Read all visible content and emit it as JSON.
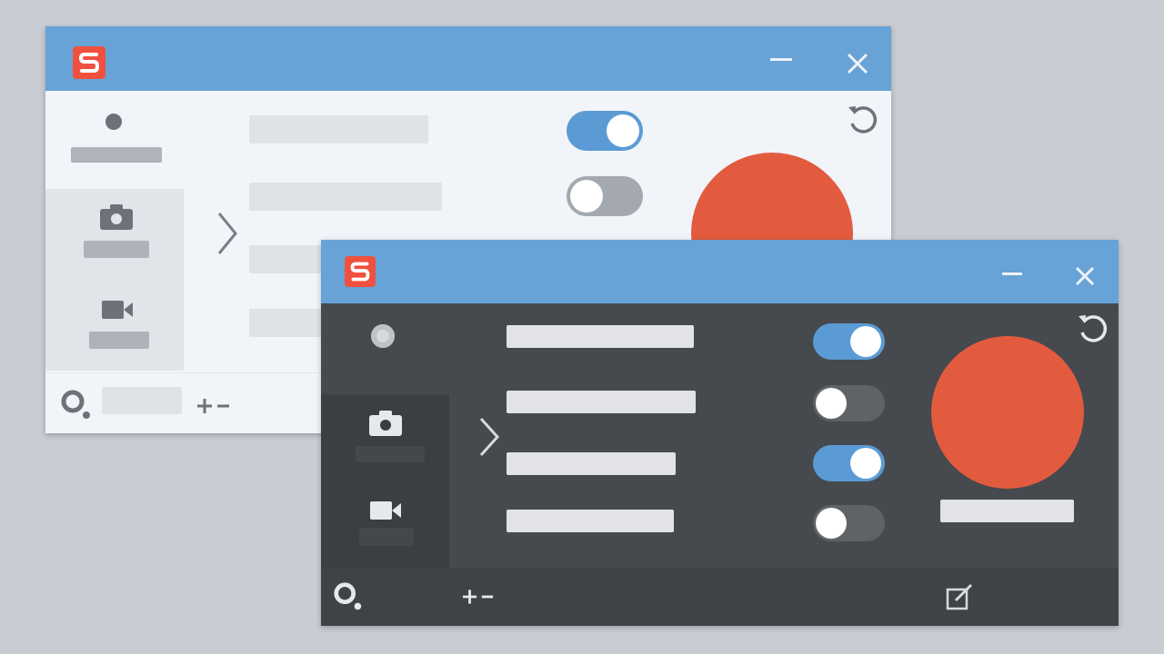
{
  "theme_colors": {
    "background": "#c9ccd3",
    "titlebar": "#67a3d6",
    "logo": "#f0513f",
    "record_button": "#e35b3f",
    "toggle_on": "#5b9bd5",
    "light_panel": "#f1f4f8",
    "dark_panel": "#46494e"
  },
  "windows": [
    {
      "theme": "light",
      "title_icon": "app-logo-icon",
      "controls": [
        "minimize-icon",
        "close-icon"
      ],
      "tabs": [
        {
          "icon": "screen-record-icon",
          "selected": false
        },
        {
          "icon": "camera-icon",
          "selected": true
        },
        {
          "icon": "video-camera-icon",
          "selected": true
        }
      ],
      "toggles": [
        true,
        false
      ],
      "footer_icons": [
        "settings-icon",
        "zoom-icon"
      ],
      "reset_icon": "reset-icon",
      "record_button": "record-button"
    },
    {
      "theme": "dark",
      "title_icon": "app-logo-icon",
      "controls": [
        "minimize-icon",
        "close-icon"
      ],
      "tabs": [
        {
          "icon": "screen-record-icon",
          "selected": false
        },
        {
          "icon": "camera-icon",
          "selected": true
        },
        {
          "icon": "video-camera-icon",
          "selected": true
        }
      ],
      "toggles": [
        true,
        false,
        true,
        false
      ],
      "footer_icons": [
        "settings-icon",
        "zoom-icon",
        "edit-icon"
      ],
      "reset_icon": "reset-icon",
      "record_button": "record-button"
    }
  ]
}
